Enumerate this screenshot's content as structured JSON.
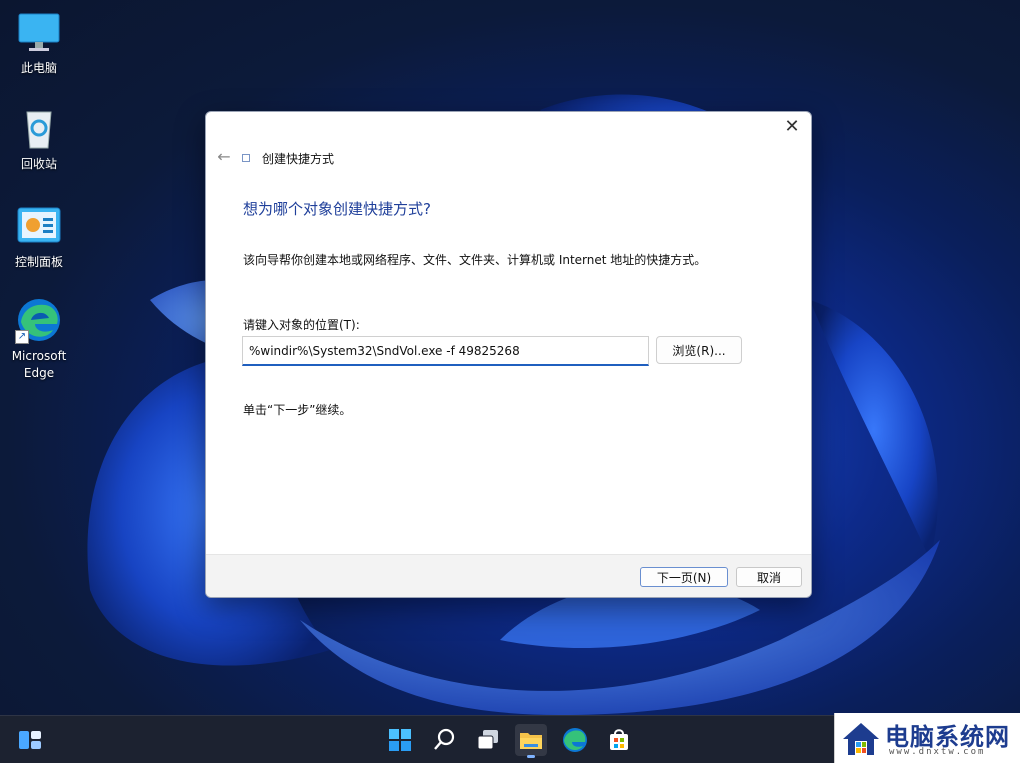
{
  "desktop": {
    "icons": [
      {
        "label": "此电脑",
        "icon": "computer-icon"
      },
      {
        "label": "回收站",
        "icon": "recycle-bin-icon"
      },
      {
        "label": "控制面板",
        "icon": "control-panel-icon"
      },
      {
        "label": "Microsoft\nEdge",
        "icon": "edge-icon"
      }
    ]
  },
  "dialog": {
    "title": "创建快捷方式",
    "heading": "想为哪个对象创建快捷方式?",
    "description": "该向导帮你创建本地或网络程序、文件、文件夹、计算机或 Internet 地址的快捷方式。",
    "field_label": "请键入对象的位置(T):",
    "location_value": "%windir%\\System32\\SndVol.exe -f 49825268",
    "browse_label": "浏览(R)...",
    "hint": "单击“下一步”继续。",
    "next_label": "下一页(N)",
    "cancel_label": "取消"
  },
  "taskbar": {
    "items": [
      "widgets-icon",
      "start-icon",
      "search-icon",
      "task-view-icon",
      "file-explorer-icon",
      "edge-icon",
      "store-icon"
    ],
    "active": "file-explorer-icon"
  },
  "watermark": {
    "title": "电脑系统网",
    "url": "www.dnxtw.com"
  },
  "colors": {
    "accent": "#1f5fbf",
    "heading": "#1f3f9a",
    "taskbar": "#1c2230"
  }
}
